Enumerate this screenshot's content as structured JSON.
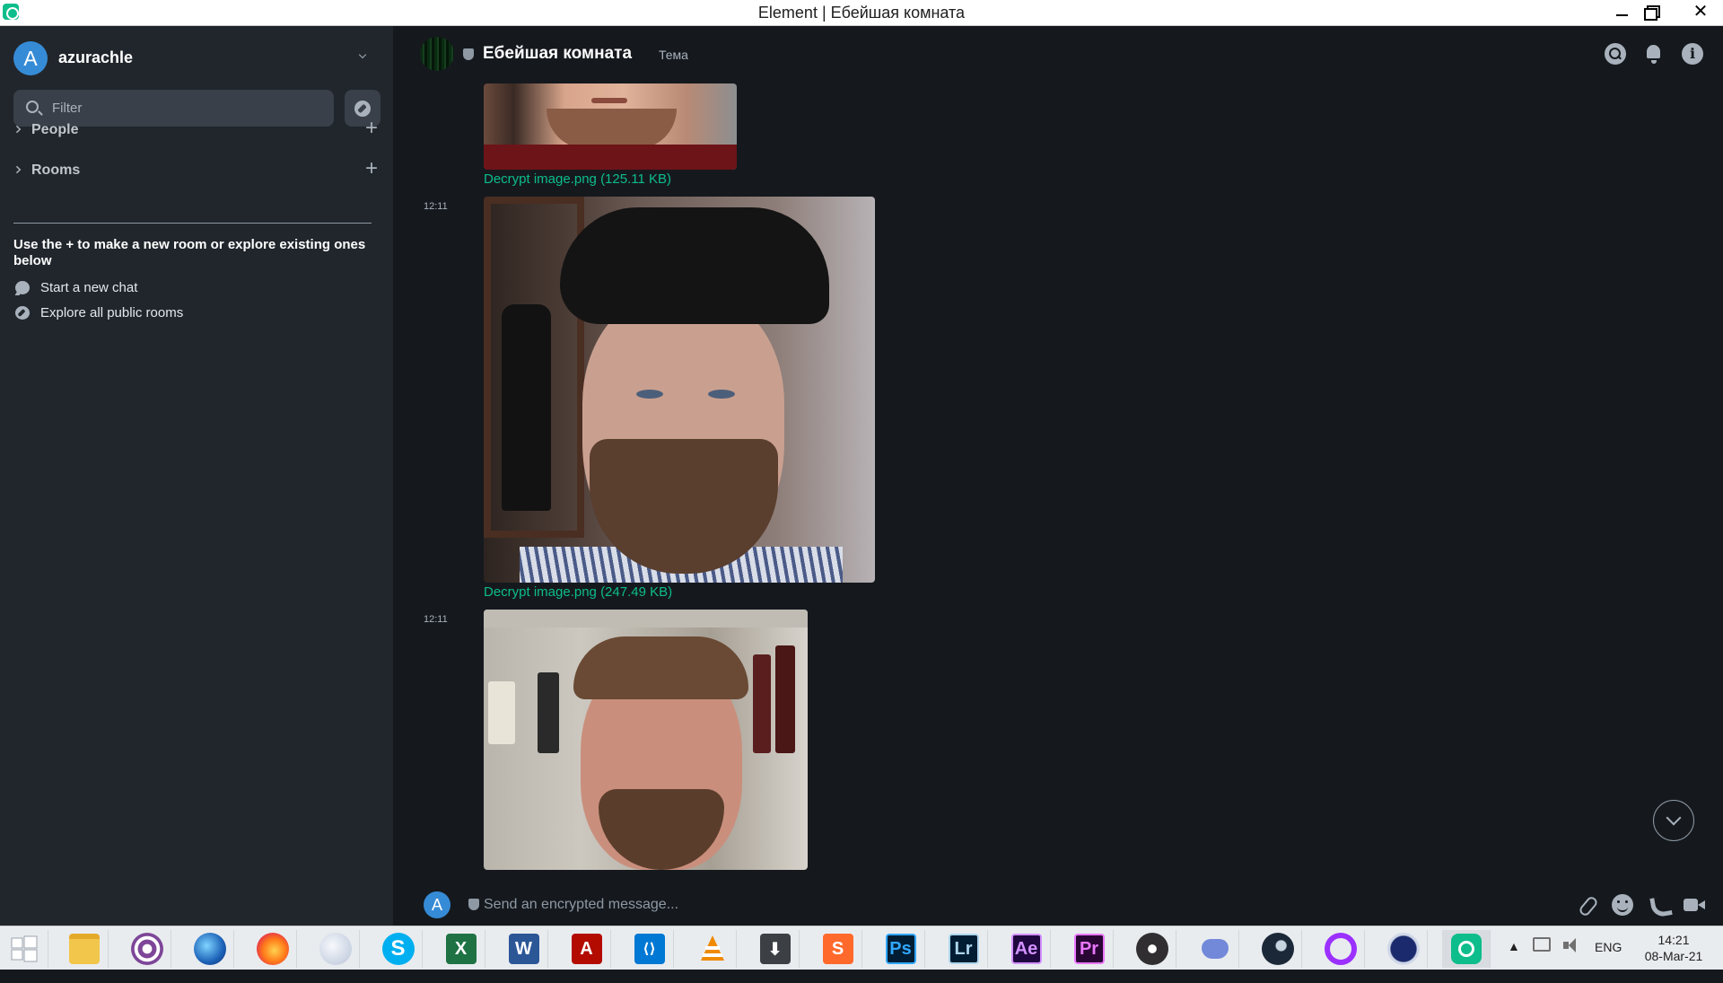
{
  "window": {
    "title": "Element | Ебейшая комната",
    "close_glyph": "✕"
  },
  "sidebar": {
    "user_initial": "A",
    "username": "azurachle",
    "filter_placeholder": "Filter",
    "sections": [
      {
        "label": "People",
        "add_glyph": "+"
      },
      {
        "label": "Rooms",
        "add_glyph": "+"
      }
    ],
    "help_text": "Use the + to make a new room or explore existing ones below",
    "help_items": [
      {
        "label": "Start a new chat",
        "icon": "chat-bubble-icon"
      },
      {
        "label": "Explore all public rooms",
        "icon": "compass-icon"
      }
    ]
  },
  "room": {
    "name": "Ебейшая комната",
    "topic": "Тема",
    "info_glyph": "i"
  },
  "timeline": {
    "events": [
      {
        "timestamp": "",
        "decrypt_label": "Decrypt image.png (125.11 KB)"
      },
      {
        "timestamp": "12:11",
        "decrypt_label": "Decrypt image.png (247.49 KB)"
      },
      {
        "timestamp": "12:11",
        "decrypt_label": ""
      }
    ]
  },
  "composer": {
    "user_initial": "A",
    "placeholder": "Send an encrypted message..."
  },
  "taskbar": {
    "apps": [
      {
        "name": "windows-start",
        "label": ""
      },
      {
        "name": "file-explorer",
        "label": ""
      },
      {
        "name": "tor-browser",
        "label": ""
      },
      {
        "name": "waterfox-browser",
        "label": ""
      },
      {
        "name": "firefox",
        "label": ""
      },
      {
        "name": "moon-app",
        "label": ""
      },
      {
        "name": "skype",
        "label": "S"
      },
      {
        "name": "excel",
        "label": "X"
      },
      {
        "name": "word",
        "label": "W"
      },
      {
        "name": "acrobat",
        "label": "A"
      },
      {
        "name": "vscode",
        "label": "⟨⟩"
      },
      {
        "name": "vlc",
        "label": ""
      },
      {
        "name": "download-manager",
        "label": "⬇"
      },
      {
        "name": "sublime",
        "label": "S"
      },
      {
        "name": "photoshop",
        "label": "Ps"
      },
      {
        "name": "lightroom",
        "label": "Lr"
      },
      {
        "name": "after-effects",
        "label": "Ae"
      },
      {
        "name": "premiere",
        "label": "Pr"
      },
      {
        "name": "obs",
        "label": ""
      },
      {
        "name": "discord",
        "label": ""
      },
      {
        "name": "steam",
        "label": ""
      },
      {
        "name": "cortana",
        "label": ""
      },
      {
        "name": "vpn-lock",
        "label": ""
      },
      {
        "name": "element",
        "label": ""
      }
    ],
    "tray": {
      "expand_glyph": "▲",
      "language": "ENG",
      "time": "14:21",
      "date": "08-Mar-21"
    }
  },
  "colors": {
    "accent": "#0dbd8b",
    "avatar": "#368bd6",
    "sidebar_bg": "#21262c",
    "room_bg": "#15191e"
  }
}
